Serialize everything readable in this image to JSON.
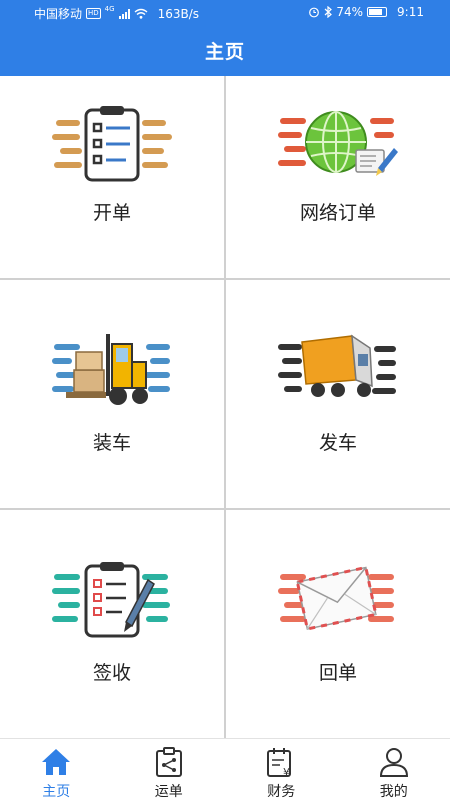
{
  "status_bar": {
    "carrier": "中国移动",
    "network_badge": "HD",
    "network_gen": "4G",
    "speed": "163B/s",
    "battery": "74%",
    "time": "9:11",
    "icons": [
      "alarm-icon",
      "bluetooth-icon",
      "battery-icon",
      "wifi-icon",
      "signal-icon"
    ]
  },
  "header": {
    "title": "主页"
  },
  "tiles": [
    {
      "label": "开单",
      "icon": "clipboard-checklist-icon"
    },
    {
      "label": "网络订单",
      "icon": "globe-order-icon"
    },
    {
      "label": "装车",
      "icon": "forklift-boxes-icon"
    },
    {
      "label": "发车",
      "icon": "truck-icon"
    },
    {
      "label": "签收",
      "icon": "sign-clipboard-icon"
    },
    {
      "label": "回单",
      "icon": "envelope-icon"
    }
  ],
  "tabbar": {
    "items": [
      {
        "label": "主页",
        "icon": "home-icon",
        "active": true
      },
      {
        "label": "运单",
        "icon": "waybill-icon",
        "active": false
      },
      {
        "label": "财务",
        "icon": "finance-calendar-icon",
        "active": false
      },
      {
        "label": "我的",
        "icon": "user-profile-icon",
        "active": false
      }
    ]
  },
  "colors": {
    "primary": "#2f7fe6",
    "divider": "#d0d0d0",
    "text": "#222222"
  }
}
